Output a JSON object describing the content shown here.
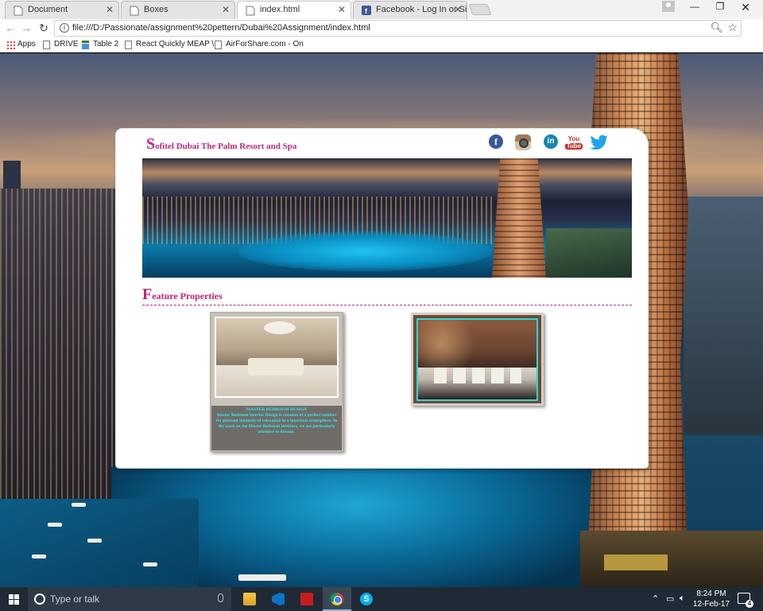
{
  "browser": {
    "tabs": [
      {
        "label": "Document",
        "active": false
      },
      {
        "label": "Boxes",
        "active": false
      },
      {
        "label": "index.html",
        "active": true
      },
      {
        "label": "Facebook - Log In or Sig",
        "active": false
      }
    ],
    "url": "file:///D:/Passionate/assignment%20pettern/Dubai%20Assignment/index.html",
    "bookmarks": [
      "Apps",
      "DRIVE",
      "Table 2",
      "React Quickly MEAP \\",
      "AirForShare.com - On"
    ]
  },
  "page": {
    "title_cap": "S",
    "title_rest": "ofitel Dubai The Palm Resort and Spa",
    "social": [
      "facebook",
      "instagram",
      "linkedin",
      "youtube",
      "twitter"
    ],
    "youtube_top": "You",
    "youtube_bottom": "Tube",
    "facebook_glyph": "f",
    "linkedin_glyph": "in",
    "section_cap": "F",
    "section_rest": "eature Properties",
    "properties": [
      {
        "caption_title": "MASTER BEDROOM DESIGN",
        "caption_text": "Master Bedroom Interior Design is creation of a perfect comfort for pleasant moments of relaxation in a luxurious atmosphere. In the work on the Master Bedroom interiors, we are particularly attentive to dreams."
      },
      {
        "caption_title": "",
        "caption_text": ""
      }
    ]
  },
  "taskbar": {
    "search_placeholder": "Type or talk",
    "time": "8:24 PM",
    "date": "12-Feb-17",
    "notification_count": "4",
    "skype_glyph": "S"
  },
  "colors": {
    "brand_pink": "#c5247a",
    "caption_cyan": "#2ee9f5"
  }
}
